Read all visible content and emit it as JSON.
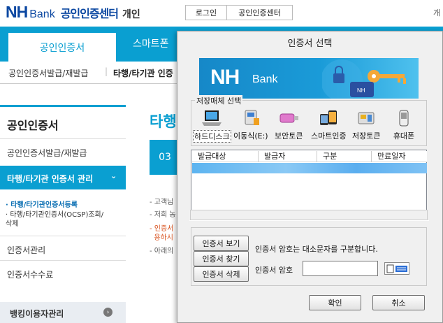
{
  "site": {
    "logo_nh": "NH",
    "logo_bank": "Bank",
    "service_name": "공인인증센터",
    "mode": "개인",
    "top_buttons": [
      "로그인",
      "공인인증센터"
    ],
    "top_extra": "개"
  },
  "nav": {
    "active_tab": "공인인증서",
    "tab2": "스마트폰"
  },
  "breadcrumb": {
    "item1": "공인인증서발급/재발급",
    "item2": "타행/타기관 인증"
  },
  "sidebar": {
    "title": "공인인증서",
    "items": [
      "공인인증서발급/재발급",
      "타행/타기관 인증서 관리",
      "인증서관리",
      "인증서수수료"
    ],
    "sub_items": [
      "· 타행/타기관인증서등록",
      "· 타행/타기관인증서(OCSP)조회/\n  삭제"
    ],
    "bottom_label": "뱅킹이용자관리"
  },
  "main": {
    "title": "타행",
    "step": "03",
    "lines": [
      "- 고객님",
      "- 저희 농",
      "- 인증서",
      "  용하시",
      "- 아래의"
    ]
  },
  "dialog": {
    "title": "인증서 선택",
    "banner_nh": "NH",
    "banner_bank": "Bank",
    "media_legend": "저장매체 선택",
    "media": [
      {
        "label": "하드디스크",
        "icon": "laptop-icon",
        "selected": true
      },
      {
        "label": "이동식(E:)",
        "icon": "usb-drive-icon",
        "selected": false
      },
      {
        "label": "보안토큰",
        "icon": "security-token-icon",
        "selected": false
      },
      {
        "label": "스마트인증",
        "icon": "smartphone-icon",
        "selected": false
      },
      {
        "label": "저장토큰",
        "icon": "storage-token-icon",
        "selected": false
      },
      {
        "label": "휴대폰",
        "icon": "mobile-phone-icon",
        "selected": false
      }
    ],
    "table_headers": [
      "발급대상",
      "발급자",
      "구분",
      "만료일자"
    ],
    "buttons": {
      "view": "인증서 보기",
      "find": "인증서 찾기",
      "delete": "인증서 삭제",
      "ok": "확인",
      "cancel": "취소"
    },
    "hint": "인증서 암호는 대소문자를 구분합니다.",
    "password_label": "인증서 암호",
    "password_value": ""
  },
  "colors": {
    "brand_blue": "#0a9fd1",
    "nh_navy": "#0b47a1",
    "selection": "#5db4f0"
  }
}
